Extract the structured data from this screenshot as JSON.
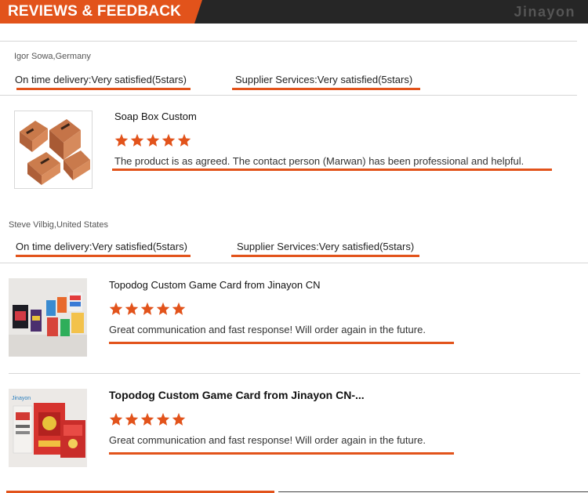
{
  "header": {
    "title": "REVIEWS & FEEDBACK",
    "logo": "Jinayon",
    "accent_color": "#e2531b",
    "bar_color": "#262626"
  },
  "reviews": [
    {
      "reviewer": "Igor Sowa,Germany",
      "delivery_rating": "On time delivery:Very satisfied(5stars)",
      "service_rating": "Supplier Services:Very satisfied(5stars)",
      "products": [
        {
          "title": "Soap Box Custom",
          "stars": 5,
          "comment": "The product is as agreed. The contact person (Marwan) has been professional and helpful.",
          "image": "kraft-soap-box-photo"
        }
      ]
    },
    {
      "reviewer": "Steve Vilbig,United States",
      "delivery_rating": "On time delivery:Very satisfied(5stars)",
      "service_rating": "Supplier Services:Very satisfied(5stars)",
      "products": [
        {
          "title": "Topodog Custom Game Card from Jinayon CN",
          "stars": 5,
          "comment": "Great communication and fast response!  Will order again in the future.",
          "image": "game-card-boxes-photo"
        },
        {
          "title": "Topodog Custom Game Card from Jinayon CN-...",
          "stars": 5,
          "comment": "Great communication and fast response!  Will order again in the future.",
          "image": "red-card-deck-photo"
        }
      ]
    }
  ],
  "star_color": "#e2531b"
}
